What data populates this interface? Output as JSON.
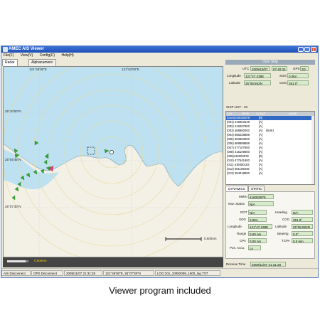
{
  "window": {
    "title": "AMEC AIS Viewer",
    "min_label": "_",
    "max_label": "□",
    "close_label": "x"
  },
  "menu": [
    "File(F)",
    "View(V)",
    "Config(C)",
    "Help(H)"
  ],
  "view_tabs": {
    "radar": "Radar View",
    "alpha": "Alphanumeric View"
  },
  "map": {
    "lon_labels": [
      "121°46'00\"E",
      "121°52'00\"E"
    ],
    "lat_labels": [
      "25°10'00\"N",
      "25°04'45\"N",
      "25°07'30\"N"
    ],
    "legend_scale": "0.500nm",
    "bottom_scale": "0.500nm"
  },
  "own_ship": {
    "header": "Own Ship",
    "utc_label": "UTC",
    "utc_date": "2009/10/07",
    "utc_time": "07:40:32",
    "gps_label": "GPS",
    "gps_value": "2D",
    "lon_label": "Longitude",
    "lon_value": "121°47.238E",
    "sog_label": "SOG",
    "sog_value": "0.0Kn",
    "lat_label": "Latitude",
    "lat_value": "25°08.862N",
    "cog_label": "COG",
    "cog_value": "351.0°"
  },
  "ship_list": {
    "title": "SHIP LIST : 18",
    "headers": [
      "NO.",
      "MMSI",
      "CLASS",
      "NAME"
    ],
    "rows": [
      {
        "text": "(Own)416003878",
        "cls": "[B]",
        "name": ""
      },
      {
        "text": "(001) 416003449",
        "cls": "[A]",
        "name": ""
      },
      {
        "text": "(002) 416267000",
        "cls": "[A]",
        "name": ""
      },
      {
        "text": "(003) 368880000",
        "cls": "[A]",
        "name": "IBUKI"
      },
      {
        "text": "(004) 666228888",
        "cls": "[A]",
        "name": ""
      },
      {
        "text": "(005) 363363000",
        "cls": "[A]",
        "name": ""
      },
      {
        "text": "(006) 888888888",
        "cls": "[A]",
        "name": ""
      },
      {
        "text": "(007) 477107600",
        "cls": "[A]",
        "name": ""
      },
      {
        "text": "(008) 416109000",
        "cls": "[A]",
        "name": ""
      },
      {
        "text": "(009)416003878",
        "cls": "[B]",
        "name": ""
      },
      {
        "text": "(010) 477641900",
        "cls": "[A]",
        "name": ""
      },
      {
        "text": "(011) 416000153",
        "cls": "[A]",
        "name": ""
      },
      {
        "text": "(012) 001193046",
        "cls": "[A]",
        "name": ""
      },
      {
        "text": "(013) 354918000",
        "cls": "[A]",
        "name": ""
      }
    ]
  },
  "dyn_tabs": {
    "dynamics": "DYNAMICS",
    "static": "STATIC"
  },
  "dynamics": {
    "mmsi_label": "MMSI",
    "mmsi_value": "416003878",
    "nav_label": "Nav. Status",
    "nav_value": "N/A",
    "rot_label": "ROT",
    "rot_value": "N/A",
    "heading_label": "Heading",
    "heading_value": "N/A",
    "sog_label": "SOG",
    "sog_value": "0.0Kn",
    "cog_label": "COG",
    "cog_value": "351.0°",
    "lon_label": "Longitude",
    "lon_value": "121°47.238E",
    "lat_label": "Latitude",
    "lat_value": "25°08.862N",
    "range_label": "Range",
    "range_value": "0.00 nm",
    "bearing_label": "Bearing",
    "bearing_value": "0.0°",
    "cpa_label": "CPA",
    "cpa_value": "0.00 nm",
    "tcpa_label": "TCPA",
    "tcpa_value": "0.0 min",
    "posacc_label": "Pos. Accu.",
    "posacc_value": "Lo",
    "recv_label": "Receive Time",
    "recv_value": "2009/11/07 21:31:28"
  },
  "status_bar": {
    "ais": "AIS Disconnect",
    "gps": "GPS Disconnect",
    "time": "2009/11/07 21:31:28",
    "pos": "121°46'00\"E, 25°07'38\"N",
    "log": "LOG:101_10082009_1600_log.TXT"
  },
  "caption": "Viewer program included",
  "colors": {
    "sea": "#bde1f0",
    "land": "#f3f1e6",
    "title_bar": "#2a5fc8",
    "field": "#d8eccb",
    "selected_row": "#316ac5"
  }
}
